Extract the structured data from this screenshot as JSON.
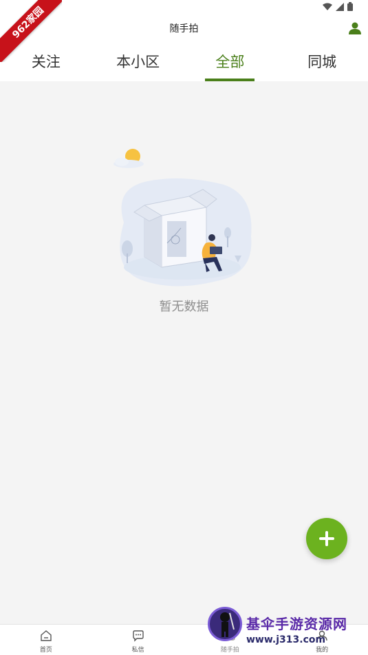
{
  "watermark_corner": {
    "text": "962家园",
    "color": "#c7121a"
  },
  "header": {
    "title": "随手拍",
    "user_icon": "person-icon",
    "accent": "#4a7f1a"
  },
  "tabs": [
    {
      "label": "关注",
      "active": false
    },
    {
      "label": "本小区",
      "active": false
    },
    {
      "label": "全部",
      "active": true
    },
    {
      "label": "同城",
      "active": false
    }
  ],
  "empty_state": {
    "text": "暂无数据",
    "icon": "empty-box-illustration"
  },
  "fab": {
    "icon": "plus-icon",
    "color": "#6cb21f"
  },
  "bottom_nav": [
    {
      "label": "首页",
      "icon": "home-icon"
    },
    {
      "label": "私信",
      "icon": "message-icon"
    },
    {
      "label": "随手拍",
      "icon": "camera-icon"
    },
    {
      "label": "我的",
      "icon": "user-icon"
    }
  ],
  "watermark_bottom": {
    "title": "基伞手游资源网",
    "url": "www.j313.com"
  }
}
